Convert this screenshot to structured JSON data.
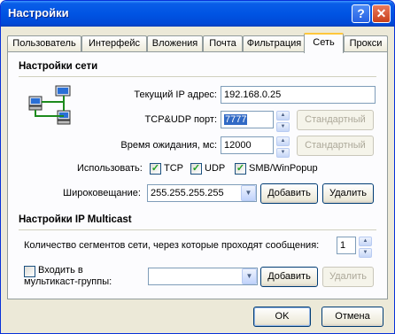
{
  "window": {
    "title": "Настройки",
    "help_glyph": "?",
    "close_glyph": "✕"
  },
  "tabs": [
    {
      "label": "Пользователь"
    },
    {
      "label": "Интерфейс"
    },
    {
      "label": "Вложения"
    },
    {
      "label": "Почта"
    },
    {
      "label": "Фильтрация"
    },
    {
      "label": "Сеть",
      "active": true
    },
    {
      "label": "Прокси"
    }
  ],
  "network": {
    "section_title": "Настройки сети",
    "ip_label": "Текущий IP адрес:",
    "ip_value": "192.168.0.25",
    "port_label": "TCP&UDP порт:",
    "port_value": "7777",
    "port_default_button": "Стандартный",
    "timeout_label": "Время ожидания, мс:",
    "timeout_value": "12000",
    "timeout_default_button": "Стандартный",
    "use_label": "Использовать:",
    "use_options": [
      {
        "label": "TCP",
        "checked": true
      },
      {
        "label": "UDP",
        "checked": true
      },
      {
        "label": "SMB/WinPopup",
        "checked": true
      }
    ],
    "broadcast_label": "Широковещание:",
    "broadcast_value": "255.255.255.255",
    "add_button": "Добавить",
    "remove_button": "Удалить"
  },
  "multicast": {
    "section_title": "Настройки IP Multicast",
    "segments_label": "Количество сегментов сети, через которые проходят сообщения:",
    "segments_value": "1",
    "join_label_line1": "Входить в",
    "join_label_line2": "мультикаст-группы:",
    "join_checked": false,
    "group_value": "",
    "add_button": "Добавить",
    "remove_button": "Удалить"
  },
  "footer": {
    "ok_button": "OK",
    "cancel_button": "Отмена"
  },
  "icons": {
    "check": "✓",
    "up": "▲",
    "down": "▼",
    "network_icon": "network-computers-icon"
  }
}
